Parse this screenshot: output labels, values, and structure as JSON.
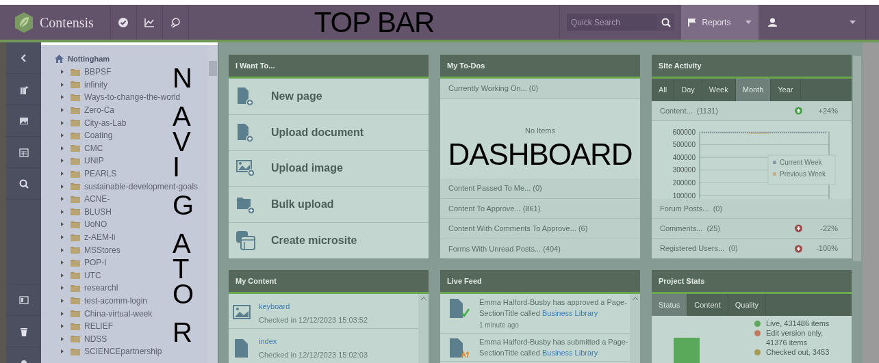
{
  "top_bar": {
    "brand": "Contensis",
    "search": {
      "placeholder": "Quick Search"
    },
    "reports": {
      "label": "Reports",
      "selected": true
    }
  },
  "annotations": [
    {
      "text": "TOP BAR"
    },
    {
      "text": "NAVIGATOR"
    },
    {
      "text": "DASHBOARD"
    }
  ],
  "navigator": {
    "root": "Nottingham",
    "children": [
      {
        "label": "BBPSF",
        "expanded": false
      },
      {
        "label": "infinity",
        "expanded": false
      },
      {
        "label": "Ways-to-change-the-world",
        "expanded": false
      },
      {
        "label": "Zero-Ca",
        "expanded": false
      },
      {
        "label": "City-as-Lab",
        "expanded": false
      },
      {
        "label": "Coating",
        "expanded": false
      },
      {
        "label": "CMC",
        "expanded": false
      },
      {
        "label": "UNIP",
        "expanded": false
      },
      {
        "label": "PEARLS",
        "expanded": false
      },
      {
        "label": "sustainable-development-goals",
        "expanded": false
      },
      {
        "label": "ACNE-",
        "expanded": false
      },
      {
        "label": "BLUSH",
        "expanded": false
      },
      {
        "label": "UoNO",
        "expanded": false
      },
      {
        "label": "z-AEM-li",
        "expanded": false
      },
      {
        "label": "MSStores",
        "expanded": false
      },
      {
        "label": "POP-I",
        "expanded": false
      },
      {
        "label": "UTC",
        "expanded": false
      },
      {
        "label": "researchl",
        "expanded": false
      },
      {
        "label": "test-acomm-login",
        "expanded": false
      },
      {
        "label": "China-virtual-week",
        "expanded": false
      },
      {
        "label": "RELIEF",
        "expanded": false
      },
      {
        "label": "NDSS",
        "expanded": false
      },
      {
        "label": "SCIENCEpartnership",
        "expanded": false
      }
    ]
  },
  "i_want_to": {
    "title": "I Want To...",
    "items": [
      {
        "label": "New page",
        "kind": "page"
      },
      {
        "label": "Upload document",
        "kind": "document"
      },
      {
        "label": "Upload image",
        "kind": "image"
      },
      {
        "label": "Bulk upload",
        "kind": "folder"
      },
      {
        "label": "Create microsite",
        "kind": "microsite"
      }
    ]
  },
  "my_todos": {
    "title": "My To-Dos",
    "current": "Currently Working On... (0)",
    "empty": "No Items",
    "rows": [
      "Content Passed To Me... (0)",
      "Content To Approve... (861)",
      "Content With Comments To Approve... (6)",
      "Forms With Unread Posts... (404)"
    ]
  },
  "site_activity": {
    "title": "Site Activity",
    "tabs": [
      {
        "label": "All",
        "selected": false
      },
      {
        "label": "Day",
        "selected": false
      },
      {
        "label": "Week",
        "selected": false
      },
      {
        "label": "Month",
        "selected": true
      },
      {
        "label": "Year",
        "selected": false
      }
    ],
    "content": {
      "label": "Content...",
      "count": "(1131)",
      "kind": "up",
      "change": "+24%"
    },
    "chart_data": {
      "type": "line",
      "grid": true,
      "legend": true,
      "yticks": [
        100000,
        200000,
        300000,
        400000,
        500000,
        600000
      ],
      "ylim": [
        100000,
        600000
      ],
      "series": [
        {
          "name": "Current Week",
          "color": "#8a9aa6",
          "line_style": "dashed",
          "values": [
            595000,
            595000,
            595000,
            595000,
            595000,
            595000,
            595000,
            595000,
            595000,
            595000,
            595000,
            595000
          ]
        },
        {
          "name": "Previous Week",
          "color": "#c4b088",
          "line_style": "dashed",
          "values": [
            null,
            null,
            null,
            null,
            590000,
            590000,
            590000,
            null,
            null,
            null,
            null,
            null
          ]
        }
      ]
    },
    "rows": [
      {
        "label": "Forum Posts...",
        "count": "(0)",
        "kind": "plain"
      },
      {
        "label": "Comments...",
        "count": "(25)",
        "kind": "down",
        "change": "-22%"
      },
      {
        "label": "Registered Users...",
        "count": "(0)",
        "kind": "down",
        "change": "-100%"
      }
    ]
  },
  "my_content": {
    "title": "My Content",
    "items": [
      {
        "name": "keyboard",
        "detail": "Checked in 12/12/2023 15:03:52",
        "kind": "image"
      },
      {
        "name": "index",
        "detail": "Checked in 12/12/2023 15:02:03",
        "kind": "page"
      }
    ]
  },
  "live_feed": {
    "title": "Live Feed",
    "items": [
      {
        "text": "Emma Halford-Busby has approved a Page-SectionTitle called",
        "link": "Business Library",
        "time": "1 minute ago",
        "kind": "approved"
      },
      {
        "text": "Emma Halford-Busby has submitted a Page-SectionTitle called",
        "link": "Business Library",
        "kind": "submitted"
      }
    ]
  },
  "project_stats": {
    "title": "Project Stats",
    "tabs": [
      {
        "label": "Status",
        "selected": true
      },
      {
        "label": "Content",
        "selected": false
      },
      {
        "label": "Quality",
        "selected": false
      }
    ],
    "legend": [
      {
        "label": "Live, 431486 items",
        "color": "#5aa85a"
      },
      {
        "label": "Edit version only, 41376 items",
        "color": "#c47a5e"
      },
      {
        "label": "Checked out, 3453",
        "color": "#a89c52"
      }
    ]
  }
}
